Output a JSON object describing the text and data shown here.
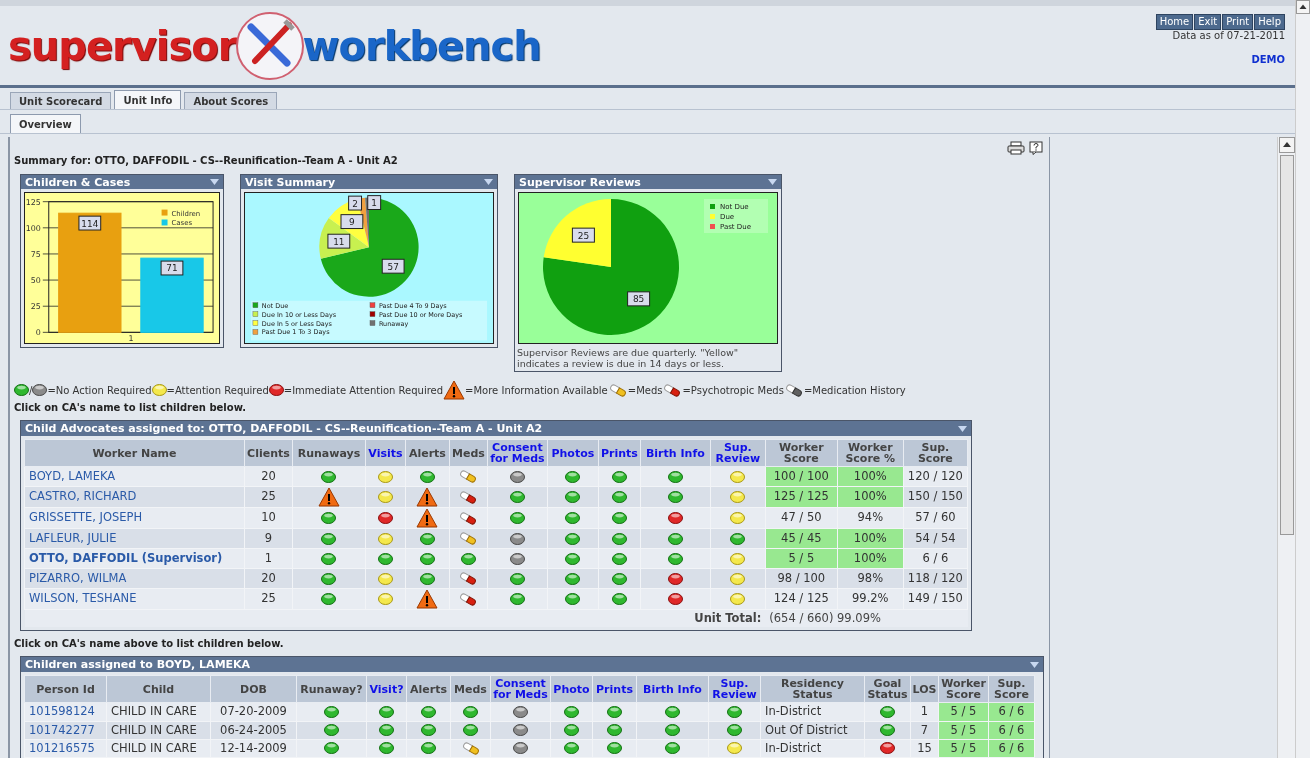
{
  "header": {
    "logo": [
      "supervisor",
      "workbench"
    ],
    "buttons": [
      "Home",
      "Exit",
      "Print",
      "Help"
    ],
    "data_date": "Data as of 07-21-2011",
    "mode": "DEMO"
  },
  "tabs": [
    {
      "label": "Unit Scorecard",
      "selected": false
    },
    {
      "label": "Unit Info",
      "selected": true
    },
    {
      "label": "About Scores",
      "selected": false
    }
  ],
  "subtabs": [
    {
      "label": "Overview",
      "selected": true
    }
  ],
  "summary": "Summary for: OTTO, DAFFODIL - CS--Reunification--Team A - Unit A2",
  "panels": [
    {
      "title": "Children & Cases",
      "chart_data": {
        "type": "bar",
        "categories": [
          "1"
        ],
        "series": [
          {
            "name": "Children",
            "color": "#e8a010",
            "values": [
              114
            ]
          },
          {
            "name": "Cases",
            "color": "#18c8e8",
            "values": [
              71
            ]
          }
        ],
        "ylim": [
          0,
          125
        ],
        "yticks": [
          0,
          25,
          50,
          75,
          100,
          125
        ],
        "grid": true,
        "legend": true,
        "data_labels": true
      }
    },
    {
      "title": "Visit Summary",
      "chart_data": {
        "type": "pie",
        "categories": [
          "Not Due",
          "Due In 10 or Less Days",
          "Due In 5 or Less Days",
          "Past Due 1 To 3 Days",
          "Past Due 4 To 9 Days",
          "Past Due 10 or More Days",
          "Runaway"
        ],
        "values": [
          57,
          11,
          9,
          2,
          0,
          0,
          1
        ],
        "colors": [
          "#1aa81a",
          "#c8f050",
          "#ffff40",
          "#f0a040",
          "#f04040",
          "#a00000",
          "#707070"
        ],
        "legend": true,
        "data_labels": true
      }
    },
    {
      "title": "Supervisor Reviews",
      "chart_data": {
        "type": "pie",
        "categories": [
          "Not Due",
          "Due",
          "Past Due"
        ],
        "values": [
          85,
          25,
          0
        ],
        "colors": [
          "#10a010",
          "#ffff30",
          "#f05050"
        ],
        "legend": true,
        "data_labels": true
      },
      "note": "Supervisor Reviews are due quarterly. \"Yellow\" indicates a review is due in 14 days or less."
    }
  ],
  "legend": [
    {
      "kind": "green"
    },
    {
      "kind": "text",
      "text": "/"
    },
    {
      "kind": "gray"
    },
    {
      "kind": "text",
      "text": "=No Action Required"
    },
    {
      "kind": "yellow"
    },
    {
      "kind": "text",
      "text": "=Attention Required"
    },
    {
      "kind": "red"
    },
    {
      "kind": "text",
      "text": "=Immediate Attention Required"
    },
    {
      "kind": "warning"
    },
    {
      "kind": "text",
      "text": "=More Information Available"
    },
    {
      "kind": "meds"
    },
    {
      "kind": "text",
      "text": "=Meds"
    },
    {
      "kind": "psych"
    },
    {
      "kind": "text",
      "text": "=Psychotropic Meds"
    },
    {
      "kind": "history"
    },
    {
      "kind": "text",
      "text": "=Medication History"
    }
  ],
  "hint_top": "Click on CA's name to list children below.",
  "advocates": {
    "title": "Child Advocates assigned to: OTTO, DAFFODIL - CS--Reunification--Team A - Unit A2",
    "columns": [
      {
        "label": "Worker Name",
        "link": false
      },
      {
        "label": "Clients",
        "link": false
      },
      {
        "label": "Runaways",
        "link": false
      },
      {
        "label": "Visits",
        "link": true
      },
      {
        "label": "Alerts",
        "link": false
      },
      {
        "label": "Meds",
        "link": false
      },
      {
        "label": "Consent for Meds",
        "link": true
      },
      {
        "label": "Photos",
        "link": true
      },
      {
        "label": "Prints",
        "link": true
      },
      {
        "label": "Birth Info",
        "link": true
      },
      {
        "label": "Sup. Review",
        "link": true
      },
      {
        "label": "Worker Score",
        "link": false
      },
      {
        "label": "Worker Score %",
        "link": false
      },
      {
        "label": "Sup. Score",
        "link": false
      }
    ],
    "rows": [
      {
        "bold": false,
        "cells": [
          {
            "kind": "text",
            "text": "BOYD, LAMEKA",
            "link": true
          },
          {
            "kind": "text",
            "text": "20"
          },
          {
            "kind": "green"
          },
          {
            "kind": "yellow"
          },
          {
            "kind": "green"
          },
          {
            "kind": "meds"
          },
          {
            "kind": "gray"
          },
          {
            "kind": "green"
          },
          {
            "kind": "green"
          },
          {
            "kind": "green"
          },
          {
            "kind": "yellow"
          },
          {
            "kind": "text",
            "text": "100 / 100",
            "highlight": true
          },
          {
            "kind": "text",
            "text": "100%",
            "highlight": true
          },
          {
            "kind": "text",
            "text": "120 / 120"
          }
        ]
      },
      {
        "bold": false,
        "cells": [
          {
            "kind": "text",
            "text": "CASTRO, RICHARD",
            "link": true
          },
          {
            "kind": "text",
            "text": "25"
          },
          {
            "kind": "warning"
          },
          {
            "kind": "yellow"
          },
          {
            "kind": "warning"
          },
          {
            "kind": "psych"
          },
          {
            "kind": "green"
          },
          {
            "kind": "green"
          },
          {
            "kind": "green"
          },
          {
            "kind": "green"
          },
          {
            "kind": "yellow"
          },
          {
            "kind": "text",
            "text": "125 / 125",
            "highlight": true
          },
          {
            "kind": "text",
            "text": "100%",
            "highlight": true
          },
          {
            "kind": "text",
            "text": "150 / 150"
          }
        ]
      },
      {
        "bold": false,
        "cells": [
          {
            "kind": "text",
            "text": "GRISSETTE, JOSEPH",
            "link": true
          },
          {
            "kind": "text",
            "text": "10"
          },
          {
            "kind": "green"
          },
          {
            "kind": "red"
          },
          {
            "kind": "warning"
          },
          {
            "kind": "psych"
          },
          {
            "kind": "green"
          },
          {
            "kind": "green"
          },
          {
            "kind": "green"
          },
          {
            "kind": "red"
          },
          {
            "kind": "yellow"
          },
          {
            "kind": "text",
            "text": "47 / 50",
            "highlight": false
          },
          {
            "kind": "text",
            "text": "94%",
            "highlight": false
          },
          {
            "kind": "text",
            "text": "57 / 60"
          }
        ]
      },
      {
        "bold": false,
        "cells": [
          {
            "kind": "text",
            "text": "LAFLEUR, JULIE",
            "link": true
          },
          {
            "kind": "text",
            "text": "9"
          },
          {
            "kind": "green"
          },
          {
            "kind": "yellow"
          },
          {
            "kind": "green"
          },
          {
            "kind": "meds"
          },
          {
            "kind": "gray"
          },
          {
            "kind": "green"
          },
          {
            "kind": "green"
          },
          {
            "kind": "green"
          },
          {
            "kind": "green"
          },
          {
            "kind": "text",
            "text": "45 / 45",
            "highlight": true
          },
          {
            "kind": "text",
            "text": "100%",
            "highlight": true
          },
          {
            "kind": "text",
            "text": "54 / 54"
          }
        ]
      },
      {
        "bold": true,
        "cells": [
          {
            "kind": "text",
            "text": "OTTO, DAFFODIL (Supervisor)",
            "link": true
          },
          {
            "kind": "text",
            "text": "1"
          },
          {
            "kind": "green"
          },
          {
            "kind": "green"
          },
          {
            "kind": "green"
          },
          {
            "kind": "green"
          },
          {
            "kind": "gray"
          },
          {
            "kind": "green"
          },
          {
            "kind": "green"
          },
          {
            "kind": "green"
          },
          {
            "kind": "yellow"
          },
          {
            "kind": "text",
            "text": "5 / 5",
            "highlight": true
          },
          {
            "kind": "text",
            "text": "100%",
            "highlight": true
          },
          {
            "kind": "text",
            "text": "6 / 6"
          }
        ]
      },
      {
        "bold": false,
        "cells": [
          {
            "kind": "text",
            "text": "PIZARRO, WILMA",
            "link": true
          },
          {
            "kind": "text",
            "text": "20"
          },
          {
            "kind": "green"
          },
          {
            "kind": "yellow"
          },
          {
            "kind": "green"
          },
          {
            "kind": "psych"
          },
          {
            "kind": "green"
          },
          {
            "kind": "green"
          },
          {
            "kind": "green"
          },
          {
            "kind": "red"
          },
          {
            "kind": "yellow"
          },
          {
            "kind": "text",
            "text": "98 / 100",
            "highlight": false
          },
          {
            "kind": "text",
            "text": "98%",
            "highlight": false
          },
          {
            "kind": "text",
            "text": "118 / 120"
          }
        ]
      },
      {
        "bold": false,
        "cells": [
          {
            "kind": "text",
            "text": "WILSON, TESHANE",
            "link": true
          },
          {
            "kind": "text",
            "text": "25"
          },
          {
            "kind": "green"
          },
          {
            "kind": "yellow"
          },
          {
            "kind": "warning"
          },
          {
            "kind": "psych"
          },
          {
            "kind": "green"
          },
          {
            "kind": "green"
          },
          {
            "kind": "green"
          },
          {
            "kind": "red"
          },
          {
            "kind": "yellow"
          },
          {
            "kind": "text",
            "text": "124 / 125",
            "highlight": false
          },
          {
            "kind": "text",
            "text": "99.2%",
            "highlight": false
          },
          {
            "kind": "text",
            "text": "149 / 150"
          }
        ]
      }
    ],
    "total_label": "Unit Total:",
    "total": "(654 / 660) 99.09%"
  },
  "hint_bottom": "Click on CA's name above to list children below.",
  "children": {
    "title": "Children assigned to BOYD, LAMEKA",
    "columns": [
      {
        "label": "Person Id",
        "link": false
      },
      {
        "label": "Child",
        "link": false
      },
      {
        "label": "DOB",
        "link": false
      },
      {
        "label": "Runaway?",
        "link": false
      },
      {
        "label": "Visit?",
        "link": true
      },
      {
        "label": "Alerts",
        "link": false
      },
      {
        "label": "Meds",
        "link": false
      },
      {
        "label": "Consent for Meds",
        "link": true
      },
      {
        "label": "Photo",
        "link": true
      },
      {
        "label": "Prints",
        "link": true
      },
      {
        "label": "Birth Info",
        "link": true
      },
      {
        "label": "Sup. Review",
        "link": true
      },
      {
        "label": "Residency Status",
        "link": false
      },
      {
        "label": "Goal Status",
        "link": false
      },
      {
        "label": "LOS",
        "link": false
      },
      {
        "label": "Worker Score",
        "link": false
      },
      {
        "label": "Sup. Score",
        "link": false
      }
    ],
    "rows": [
      {
        "bold": false,
        "cells": [
          {
            "kind": "text",
            "text": "101598124",
            "link": true
          },
          {
            "kind": "text",
            "text": "CHILD IN CARE"
          },
          {
            "kind": "text",
            "text": "07-20-2009"
          },
          {
            "kind": "green"
          },
          {
            "kind": "green"
          },
          {
            "kind": "green"
          },
          {
            "kind": "green"
          },
          {
            "kind": "gray"
          },
          {
            "kind": "green"
          },
          {
            "kind": "green"
          },
          {
            "kind": "green"
          },
          {
            "kind": "green"
          },
          {
            "kind": "text",
            "text": "In-District"
          },
          {
            "kind": "green"
          },
          {
            "kind": "text",
            "text": "1"
          },
          {
            "kind": "text",
            "text": "5 / 5",
            "highlight": true
          },
          {
            "kind": "text",
            "text": "6 / 6",
            "highlight": true
          }
        ]
      },
      {
        "bold": false,
        "cells": [
          {
            "kind": "text",
            "text": "101742277",
            "link": true
          },
          {
            "kind": "text",
            "text": "CHILD IN CARE"
          },
          {
            "kind": "text",
            "text": "06-24-2005"
          },
          {
            "kind": "green"
          },
          {
            "kind": "green"
          },
          {
            "kind": "green"
          },
          {
            "kind": "green"
          },
          {
            "kind": "gray"
          },
          {
            "kind": "green"
          },
          {
            "kind": "green"
          },
          {
            "kind": "green"
          },
          {
            "kind": "green"
          },
          {
            "kind": "text",
            "text": "Out Of District"
          },
          {
            "kind": "green"
          },
          {
            "kind": "text",
            "text": "7"
          },
          {
            "kind": "text",
            "text": "5 / 5",
            "highlight": true
          },
          {
            "kind": "text",
            "text": "6 / 6",
            "highlight": true
          }
        ]
      },
      {
        "bold": false,
        "cells": [
          {
            "kind": "text",
            "text": "101216575",
            "link": true
          },
          {
            "kind": "text",
            "text": "CHILD IN CARE"
          },
          {
            "kind": "text",
            "text": "12-14-2009"
          },
          {
            "kind": "green"
          },
          {
            "kind": "green"
          },
          {
            "kind": "green"
          },
          {
            "kind": "meds"
          },
          {
            "kind": "gray"
          },
          {
            "kind": "green"
          },
          {
            "kind": "green"
          },
          {
            "kind": "green"
          },
          {
            "kind": "yellow"
          },
          {
            "kind": "text",
            "text": "In-District"
          },
          {
            "kind": "red"
          },
          {
            "kind": "text",
            "text": "15"
          },
          {
            "kind": "text",
            "text": "5 / 5",
            "highlight": true
          },
          {
            "kind": "text",
            "text": "6 / 6",
            "highlight": true
          }
        ]
      }
    ]
  }
}
